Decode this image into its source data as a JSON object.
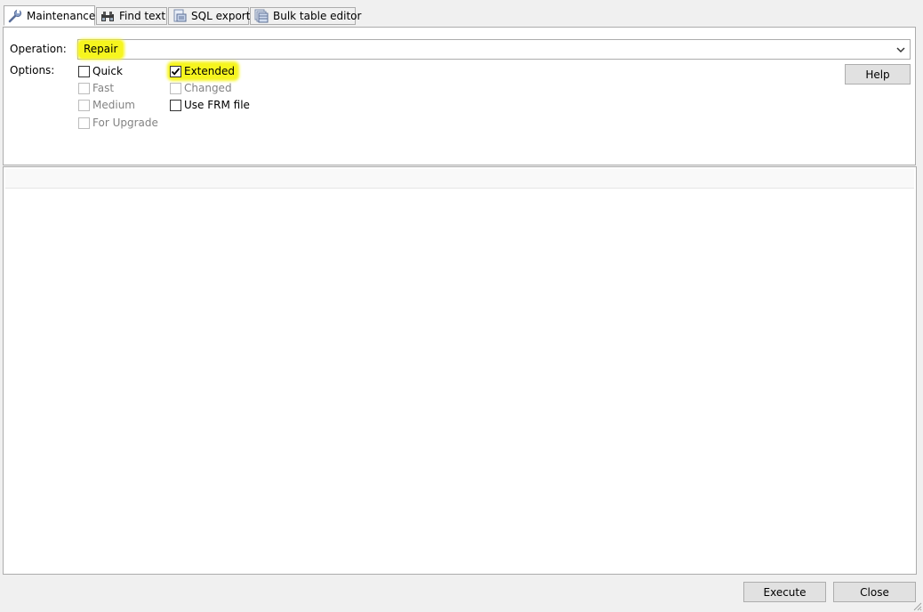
{
  "tabs": [
    {
      "label": "Maintenance",
      "icon": "wrench-icon",
      "active": true
    },
    {
      "label": "Find text",
      "icon": "binoculars-icon",
      "active": false
    },
    {
      "label": "SQL export",
      "icon": "sql-export-icon",
      "active": false
    },
    {
      "label": "Bulk table editor",
      "icon": "bulk-table-icon",
      "active": false
    }
  ],
  "form": {
    "operation_label": "Operation:",
    "operation_value": "Repair",
    "options_label": "Options:"
  },
  "options": {
    "quick": {
      "label": "Quick",
      "checked": false,
      "enabled": true
    },
    "fast": {
      "label": "Fast",
      "checked": false,
      "enabled": false
    },
    "medium": {
      "label": "Medium",
      "checked": false,
      "enabled": false
    },
    "for_upgrade": {
      "label": "For Upgrade",
      "checked": false,
      "enabled": false
    },
    "extended": {
      "label": "Extended",
      "checked": true,
      "enabled": true
    },
    "changed": {
      "label": "Changed",
      "checked": false,
      "enabled": false
    },
    "use_frm_file": {
      "label": "Use FRM file",
      "checked": false,
      "enabled": true
    }
  },
  "buttons": {
    "help": "Help",
    "execute": "Execute",
    "close": "Close"
  },
  "colors": {
    "highlight": "#f6f51e",
    "panel_border": "#acacac",
    "window_bg": "#f0f0f0"
  }
}
